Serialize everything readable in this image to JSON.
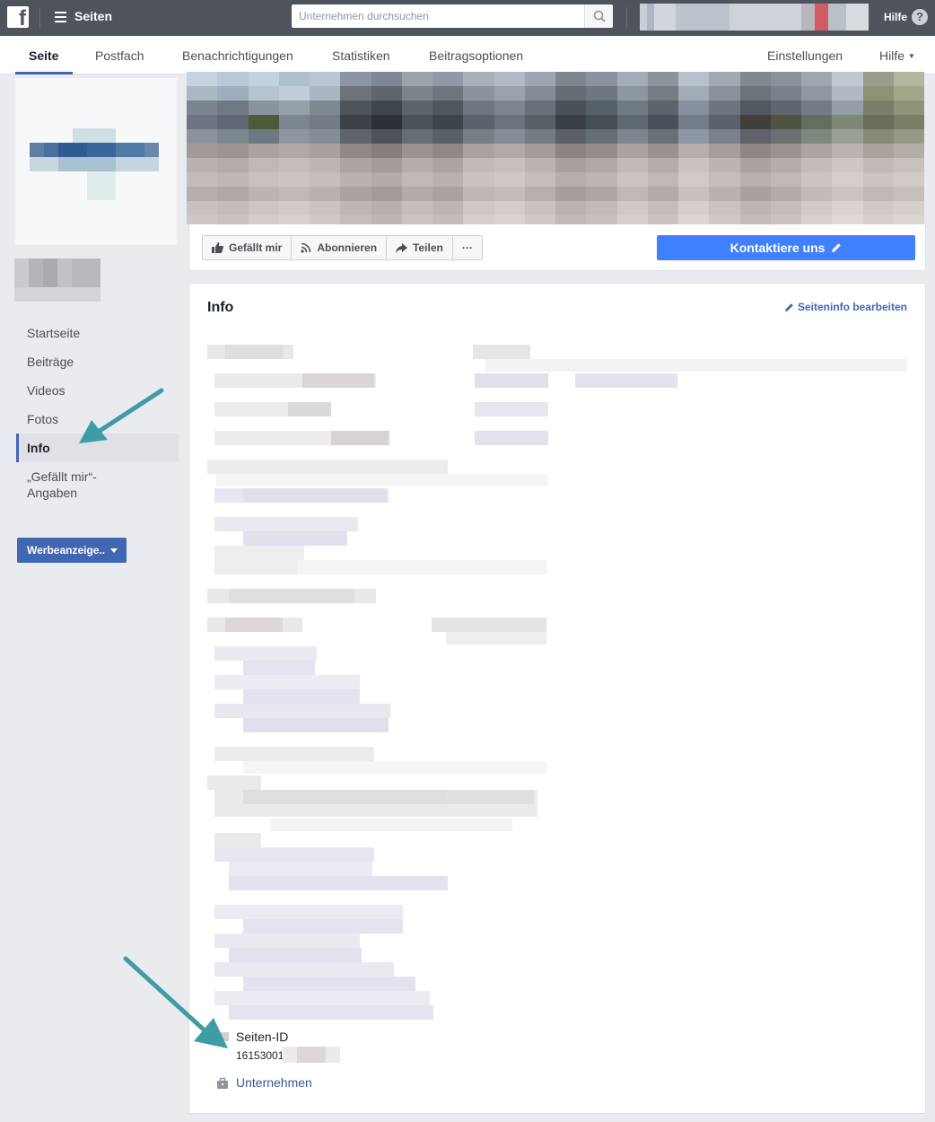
{
  "topbar": {
    "logo": "f",
    "title": "Seiten",
    "search_placeholder": "Unternehmen durchsuchen",
    "help_label": "Hilfe",
    "help_glyph": "?"
  },
  "tabs": {
    "seite": "Seite",
    "postfach": "Postfach",
    "benachrichtigungen": "Benachrichtigungen",
    "statistiken": "Statistiken",
    "beitragsoptionen": "Beitragsoptionen",
    "einstellungen": "Einstellungen",
    "hilfe": "Hilfe"
  },
  "sidebar": {
    "items": [
      {
        "label": "Startseite"
      },
      {
        "label": "Beiträge"
      },
      {
        "label": "Videos"
      },
      {
        "label": "Fotos"
      },
      {
        "label": "Info"
      },
      {
        "label": "„Gefällt mir“-Angaben"
      }
    ],
    "promote_label": "Werbeanzeige.."
  },
  "actions": {
    "like": "Gefällt mir",
    "follow": "Abonnieren",
    "share": "Teilen",
    "more": "···",
    "contact": "Kontaktiere uns"
  },
  "info": {
    "title": "Info",
    "edit_label": "Seiteninfo bearbeiten",
    "page_id_label": "Seiten-ID",
    "page_id_value": "16153001",
    "category_label": "Unternehmen"
  },
  "colors": {
    "brand_blue": "#4267b2",
    "contact_blue": "#4080ff",
    "arrow_teal": "#3e9ca5"
  }
}
